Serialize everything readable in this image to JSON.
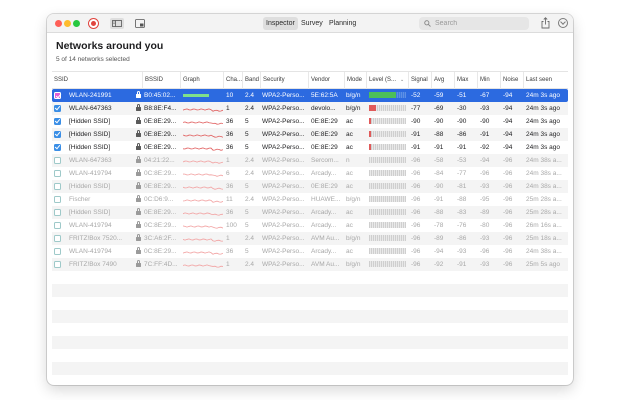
{
  "toolbar": {
    "tabs": [
      {
        "label": "Inspector",
        "active": true
      },
      {
        "label": "Survey",
        "active": false
      },
      {
        "label": "Planning",
        "active": false
      }
    ],
    "search_placeholder": "Search"
  },
  "header": {
    "title": "Networks around you",
    "subtitle": "5 of 14 networks selected"
  },
  "table": {
    "columns": [
      "SSID",
      "BSSID",
      "Graph",
      "Cha...",
      "Band",
      "Security",
      "Vendor",
      "Mode",
      "Level (S...",
      "Signal",
      "Avg",
      "Max",
      "Min",
      "Noise",
      "Last seen"
    ],
    "sorted_column": "Level (S...",
    "rows": [
      {
        "checked": true,
        "selected": true,
        "ssid": "WLAN-241991",
        "bssid": "B0:45:02...",
        "channel": "10",
        "band": "2.4",
        "security": "WPA2-Perso...",
        "vendor": "5E:62:5A",
        "mode": "b/g/n",
        "level": 0.72,
        "level_color": "#4cbf5a",
        "signal": "-52",
        "avg": "-59",
        "max": "-51",
        "min": "-67",
        "noise": "-94",
        "last_seen": "24m 3s ago",
        "graph_color": "#4cbf5a"
      },
      {
        "checked": true,
        "selected": false,
        "ssid": "WLAN-647363",
        "bssid": "B8:8E:F4...",
        "channel": "1",
        "band": "2.4",
        "security": "WPA2-Perso...",
        "vendor": "devolo...",
        "mode": "b/g/n",
        "level": 0.2,
        "level_color": "#e05a5a",
        "signal": "-77",
        "avg": "-69",
        "max": "-30",
        "min": "-93",
        "noise": "-94",
        "last_seen": "24m 3s ago",
        "graph_color": "#e05a5a"
      },
      {
        "checked": true,
        "selected": false,
        "ssid": "[Hidden SSID]",
        "bssid": "0E:8E:29...",
        "channel": "36",
        "band": "5",
        "security": "WPA2-Perso...",
        "vendor": "0E:8E:29",
        "mode": "ac",
        "level": 0.05,
        "level_color": "#e05a5a",
        "signal": "-90",
        "avg": "-90",
        "max": "-90",
        "min": "-90",
        "noise": "-94",
        "last_seen": "24m 3s ago",
        "graph_color": "#e05a5a"
      },
      {
        "checked": true,
        "selected": false,
        "ssid": "[Hidden SSID]",
        "bssid": "0E:8E:29...",
        "channel": "36",
        "band": "5",
        "security": "WPA2-Perso...",
        "vendor": "0E:8E:29",
        "mode": "ac",
        "level": 0.05,
        "level_color": "#e05a5a",
        "signal": "-91",
        "avg": "-88",
        "max": "-86",
        "min": "-91",
        "noise": "-94",
        "last_seen": "24m 3s ago",
        "graph_color": "#e05a5a"
      },
      {
        "checked": true,
        "selected": false,
        "ssid": "[Hidden SSID]",
        "bssid": "0E:8E:29...",
        "channel": "36",
        "band": "5",
        "security": "WPA2-Perso...",
        "vendor": "0E:8E:29",
        "mode": "ac",
        "level": 0.05,
        "level_color": "#e05a5a",
        "signal": "-91",
        "avg": "-91",
        "max": "-91",
        "min": "-92",
        "noise": "-94",
        "last_seen": "24m 3s ago",
        "graph_color": "#e05a5a"
      },
      {
        "checked": false,
        "selected": false,
        "ssid": "WLAN-647363",
        "bssid": "04:21:22...",
        "channel": "1",
        "band": "2.4",
        "security": "WPA2-Perso...",
        "vendor": "Sercom...",
        "mode": "n",
        "level": 0,
        "level_color": "#e05a5a",
        "signal": "-96",
        "avg": "-58",
        "max": "-53",
        "min": "-94",
        "noise": "-96",
        "last_seen": "24m 38s a...",
        "graph_color": "#f2a0a0"
      },
      {
        "checked": false,
        "selected": false,
        "ssid": "WLAN-419794",
        "bssid": "0C:8E:29...",
        "channel": "6",
        "band": "2.4",
        "security": "WPA2-Perso...",
        "vendor": "Arcady...",
        "mode": "ac",
        "level": 0,
        "level_color": "#e05a5a",
        "signal": "-96",
        "avg": "-84",
        "max": "-77",
        "min": "-96",
        "noise": "-96",
        "last_seen": "24m 38s a...",
        "graph_color": "#f2a0a0"
      },
      {
        "checked": false,
        "selected": false,
        "ssid": "[Hidden SSID]",
        "bssid": "0E:8E:29...",
        "channel": "36",
        "band": "5",
        "security": "WPA2-Perso...",
        "vendor": "0E:8E:29",
        "mode": "ac",
        "level": 0,
        "level_color": "#e05a5a",
        "signal": "-96",
        "avg": "-90",
        "max": "-81",
        "min": "-93",
        "noise": "-96",
        "last_seen": "24m 38s a...",
        "graph_color": "#f2a0a0"
      },
      {
        "checked": false,
        "selected": false,
        "ssid": "Fischer",
        "bssid": "0C:D6:9...",
        "channel": "11",
        "band": "2.4",
        "security": "WPA2-Perso...",
        "vendor": "HUAWE...",
        "mode": "b/g/n",
        "level": 0,
        "level_color": "#e05a5a",
        "signal": "-96",
        "avg": "-91",
        "max": "-88",
        "min": "-95",
        "noise": "-96",
        "last_seen": "25m 28s a...",
        "graph_color": "#f2a0a0"
      },
      {
        "checked": false,
        "selected": false,
        "ssid": "[Hidden SSID]",
        "bssid": "0E:8E:29...",
        "channel": "36",
        "band": "5",
        "security": "WPA2-Perso...",
        "vendor": "Arcady...",
        "mode": "ac",
        "level": 0,
        "level_color": "#e05a5a",
        "signal": "-96",
        "avg": "-88",
        "max": "-83",
        "min": "-89",
        "noise": "-96",
        "last_seen": "25m 28s a...",
        "graph_color": "#f2a0a0"
      },
      {
        "checked": false,
        "selected": false,
        "ssid": "WLAN-419794",
        "bssid": "0C:8E:29...",
        "channel": "100",
        "band": "5",
        "security": "WPA2-Perso...",
        "vendor": "Arcady...",
        "mode": "ac",
        "level": 0,
        "level_color": "#e05a5a",
        "signal": "-96",
        "avg": "-78",
        "max": "-76",
        "min": "-80",
        "noise": "-96",
        "last_seen": "26m 16s a...",
        "graph_color": "#f2a0a0"
      },
      {
        "checked": false,
        "selected": false,
        "ssid": "FRITZ!Box 7520...",
        "bssid": "3C:A6:2F...",
        "channel": "1",
        "band": "2.4",
        "security": "WPA2-Perso...",
        "vendor": "AVM Au...",
        "mode": "b/g/n",
        "level": 0,
        "level_color": "#e05a5a",
        "signal": "-96",
        "avg": "-89",
        "max": "-86",
        "min": "-93",
        "noise": "-96",
        "last_seen": "25m 18s a...",
        "graph_color": "#f2a0a0"
      },
      {
        "checked": false,
        "selected": false,
        "ssid": "WLAN-419794",
        "bssid": "0C:8E:29...",
        "channel": "36",
        "band": "5",
        "security": "WPA2-Perso...",
        "vendor": "Arcady...",
        "mode": "ac",
        "level": 0,
        "level_color": "#e05a5a",
        "signal": "-96",
        "avg": "-94",
        "max": "-93",
        "min": "-96",
        "noise": "-96",
        "last_seen": "24m 38s a...",
        "graph_color": "#f2a0a0"
      },
      {
        "checked": false,
        "selected": false,
        "ssid": "FRITZ!Box 7490",
        "bssid": "7C:FF:4D...",
        "channel": "1",
        "band": "2.4",
        "security": "WPA2-Perso...",
        "vendor": "AVM Au...",
        "mode": "b/g/n",
        "level": 0,
        "level_color": "#e05a5a",
        "signal": "-96",
        "avg": "-92",
        "max": "-91",
        "min": "-93",
        "noise": "-96",
        "last_seen": "25m 5s ago",
        "graph_color": "#f2a0a0"
      }
    ]
  },
  "colors": {
    "accent": "#2c6ae0",
    "checkbox": "#3a8ee6",
    "selected_checkbox": "#e25bd6"
  }
}
